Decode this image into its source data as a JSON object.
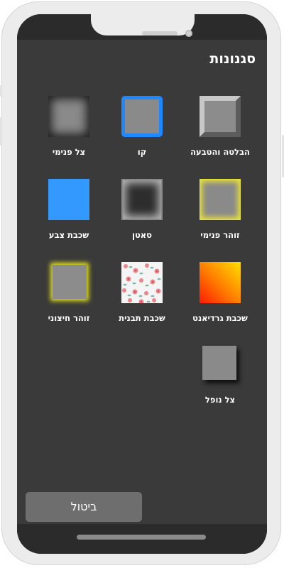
{
  "header": {
    "title": "סגנונות"
  },
  "styles": {
    "bevel_emboss": {
      "label": "הבלטה והטבעה"
    },
    "stroke": {
      "label": "קו"
    },
    "inner_shadow": {
      "label": "צל פנימי"
    },
    "inner_glow": {
      "label": "זוהר פנימי"
    },
    "satin": {
      "label": "סאטן"
    },
    "color_overlay": {
      "label": "שכבת צבע"
    },
    "gradient_overlay": {
      "label": "שכבת גרדיאנט"
    },
    "pattern_overlay": {
      "label": "שכבת תבנית"
    },
    "outer_glow": {
      "label": "זוהר חיצוני"
    },
    "drop_shadow": {
      "label": "צל נופל"
    }
  },
  "footer": {
    "cancel_label": "ביטול"
  },
  "colors": {
    "stroke_blue": "#1f88ff",
    "color_overlay_blue": "#3399ff",
    "glow_yellow": "#e8e23a",
    "gradient": [
      "#ff1a00",
      "#ff7a00",
      "#ffe000"
    ],
    "screen_background": "#3a3a3a"
  }
}
